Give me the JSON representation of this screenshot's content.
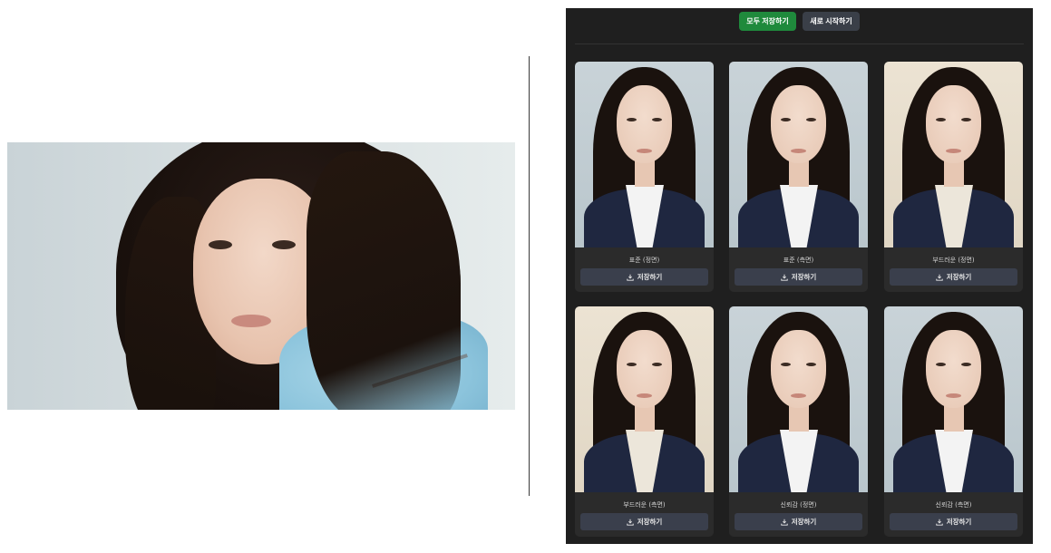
{
  "toolbar": {
    "save_all_label": "모두 저장하기",
    "restart_label": "새로 시작하기"
  },
  "results": [
    {
      "label": "표준 (정면)",
      "save_label": "저장하기",
      "background": "cool"
    },
    {
      "label": "표준 (측면)",
      "save_label": "저장하기",
      "background": "cool"
    },
    {
      "label": "부드러운 (정면)",
      "save_label": "저장하기",
      "background": "warm"
    },
    {
      "label": "부드러운 (측면)",
      "save_label": "저장하기",
      "background": "warm"
    },
    {
      "label": "신뢰감 (정면)",
      "save_label": "저장하기",
      "background": "cool"
    },
    {
      "label": "신뢰감 (측면)",
      "save_label": "저장하기",
      "background": "cool"
    }
  ],
  "colors": {
    "panel_bg": "#1f1f1f",
    "card_bg": "#2b2b2b",
    "primary_green": "#1f8a3c",
    "secondary_button": "#3a3f48",
    "save_button": "#3a3f4c"
  },
  "icons": {
    "download": "download-icon"
  }
}
